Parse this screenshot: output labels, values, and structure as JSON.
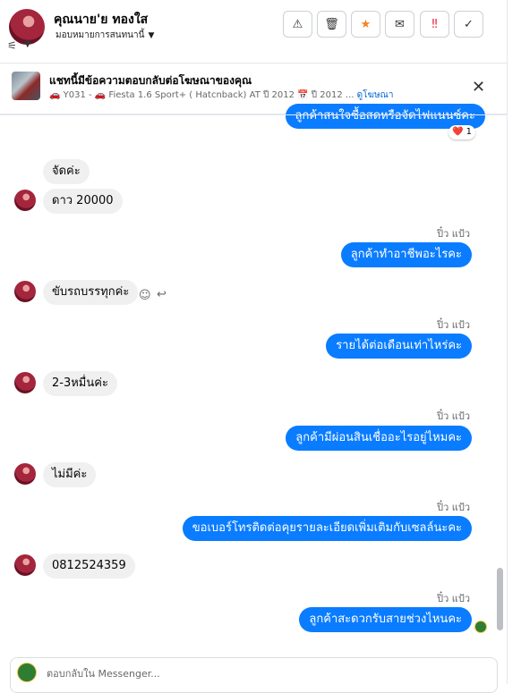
{
  "header": {
    "contact_name": "คุณนาย'ย ทองใส",
    "assign_label": "มอบหมายการสนทนานี้",
    "buttons": {
      "report": "⚠",
      "delete": "🗑",
      "star": "★",
      "mail": "✉",
      "spam": "‼",
      "done": "✓"
    }
  },
  "ad_bar": {
    "title": "แชทนี้มีข้อความตอบกลับต่อโฆษณาของคุณ",
    "subtitle": "🚗 Y031 - 🚗 Fiesta 1.6 Sport+ ( Hatcnback) AT ปี 2012 📅 ปี 2012 ...",
    "link": "ดูโฆษณา",
    "close": "✕"
  },
  "messages": {
    "top_partial": "ลูกค้าสนใจซื้อสดหรือจัดไฟแนนซ์คะ",
    "reaction": "❤️ 1",
    "m1": "จัดค่ะ",
    "m2": "ดาว 20000",
    "s1": "ปิ๋ว แป้ว",
    "o1": "ลูกค้าทำอาชีพอะไรคะ",
    "m3": "ขับรถบรรทุกค่ะ",
    "s2": "ปิ๋ว แป้ว",
    "o2": "รายได้ต่อเดือนเท่าไหร่คะ",
    "m4": "2-3หมื่นค่ะ",
    "s3": "ปิ๋ว แป้ว",
    "o3": "ลูกค้ามีผ่อนสินเชื่ออะไรอยู่ไหมคะ",
    "m5": "ไม่มีค่ะ",
    "s4": "ปิ๋ว แป้ว",
    "o4": "ขอเบอร์โทรติดต่อคุยรายละเอียดเพิ่มเติมกับเซลล์นะคะ",
    "m6": "0812524359",
    "s5": "ปิ๋ว แป้ว",
    "o5": "ลูกค้าสะดวกรับสายช่วงไหนคะ"
  },
  "composer": {
    "placeholder": "ตอบกลับใน Messenger..."
  },
  "colors": {
    "outgoing": "#0a7cff",
    "incoming": "#f0f0f0",
    "star": "#f5821f",
    "spam": "#e41e3f"
  }
}
